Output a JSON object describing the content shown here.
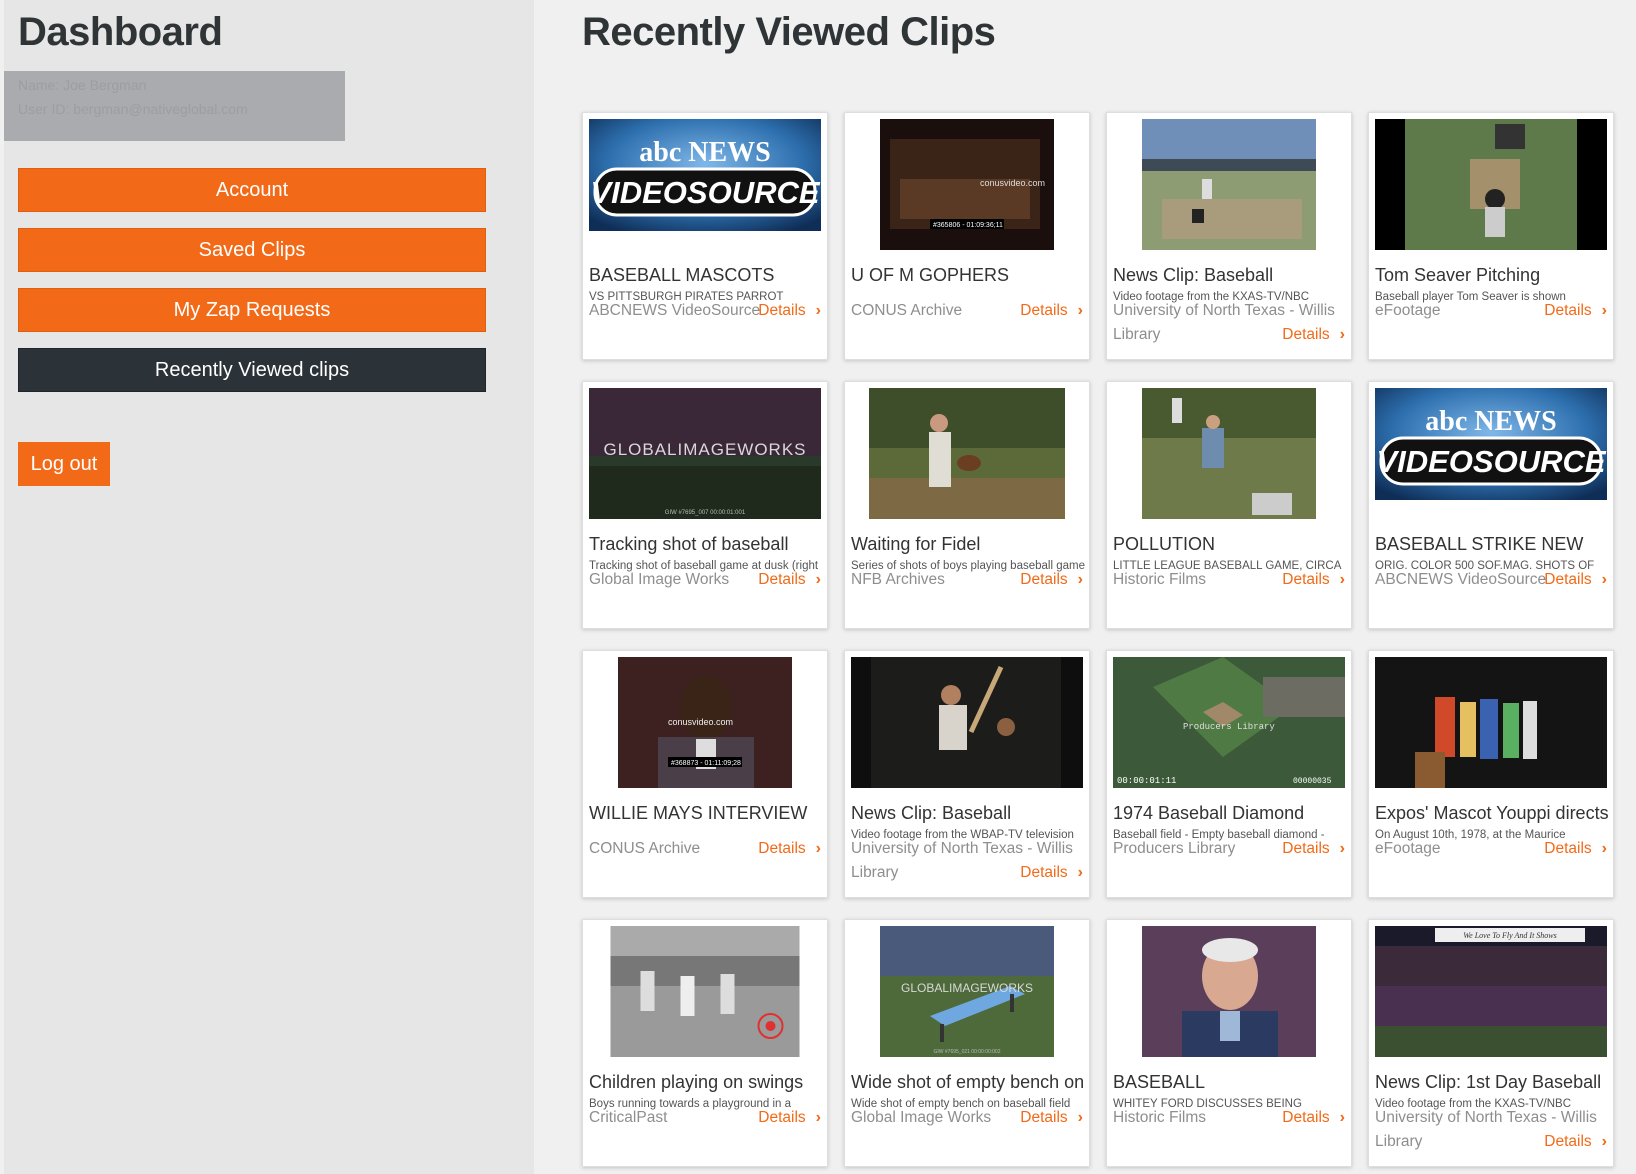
{
  "sidebar": {
    "title": "Dashboard",
    "user_name": "Name: Joe Bergman",
    "user_email": "User ID: bergman@nativeglobal.com",
    "nav": [
      {
        "label": "Account",
        "active": false
      },
      {
        "label": "Saved Clips",
        "active": false
      },
      {
        "label": "My Zap Requests",
        "active": false
      },
      {
        "label": "Recently Viewed clips",
        "active": true
      }
    ],
    "logout_label": "Log out"
  },
  "main": {
    "title": "Recently Viewed Clips",
    "details_label": "Details",
    "cards": [
      {
        "title": "BASEBALL MASCOTS",
        "desc": "VS PITTSBURGH PIRATES PARROT",
        "source": "ABCNEWS VideoSource",
        "thumb": "abc",
        "thumb_text": [
          "abc NEWS",
          "VIDEOSOURCE"
        ]
      },
      {
        "title": "U OF M GOPHERS",
        "desc": "",
        "source": "CONUS Archive",
        "thumb": "conus1",
        "thumb_text": [
          "conusvideo.com",
          "#365806 - 01:09:36;11"
        ]
      },
      {
        "title": "News Clip: Baseball",
        "desc": "Video footage from the KXAS-TV/NBC",
        "source": "University of North Texas - Willis Library",
        "thumb": "field1",
        "thumb_text": []
      },
      {
        "title": "Tom Seaver Pitching",
        "desc": "Baseball player Tom Seaver is shown",
        "source": "eFootage",
        "thumb": "pitch",
        "thumb_text": []
      },
      {
        "title": "Tracking shot of baseball",
        "desc": "Tracking shot of baseball game at dusk (right",
        "source": "Global Image Works",
        "thumb": "gw_night",
        "thumb_text": [
          "GLOBALIMAGEWORKS",
          "GIW #7695_007  00:00:01:001"
        ]
      },
      {
        "title": "Waiting for Fidel",
        "desc": "Series of shots of boys playing baseball game",
        "source": "NFB Archives",
        "thumb": "boy",
        "thumb_text": []
      },
      {
        "title": "POLLUTION",
        "desc": "LITTLE LEAGUE BASEBALL GAME, CIRCA",
        "source": "Historic Films",
        "thumb": "little",
        "thumb_text": []
      },
      {
        "title": "BASEBALL STRIKE NEW",
        "desc": "ORIG. COLOR 500 SOF.MAG. SHOTS OF",
        "source": "ABCNEWS VideoSource",
        "thumb": "abc",
        "thumb_text": [
          "abc NEWS",
          "VIDEOSOURCE"
        ]
      },
      {
        "title": "WILLIE MAYS INTERVIEW",
        "desc": "",
        "source": "CONUS Archive",
        "thumb": "conus2",
        "thumb_text": [
          "conusvideo.com",
          "#368873 - 01:11:09;28"
        ]
      },
      {
        "title": "News Clip: Baseball",
        "desc": "Video footage from the WBAP-TV television",
        "source": "University of North Texas - Willis Library",
        "thumb": "bat",
        "thumb_text": []
      },
      {
        "title": "1974 Baseball Diamond",
        "desc": "Baseball field - Empty baseball diamond -",
        "source": "Producers Library",
        "thumb": "aerial",
        "thumb_text": [
          "Producers Library",
          "00:00:01:11",
          "00000035"
        ]
      },
      {
        "title": "Expos' Mascot Youppi directs",
        "desc": "On August 10th, 1978, at the Maurice",
        "source": "eFootage",
        "thumb": "stage",
        "thumb_text": []
      },
      {
        "title": "Children playing on swings",
        "desc": "Boys running towards a playground in a",
        "source": "CriticalPast",
        "thumb": "bw",
        "thumb_text": []
      },
      {
        "title": "Wide shot of empty bench on",
        "desc": "Wide shot of empty bench on baseball field",
        "source": "Global Image Works",
        "thumb": "bench",
        "thumb_text": [
          "GLOBALIMAGEWORKS",
          "GIW #7695_021  00:00:00:002"
        ]
      },
      {
        "title": "BASEBALL",
        "desc": "WHITEY FORD DISCUSSES BEING",
        "source": "Historic Films",
        "thumb": "man",
        "thumb_text": []
      },
      {
        "title": "News Clip: 1st Day Baseball",
        "desc": "Video footage from the KXAS-TV/NBC",
        "source": "University of North Texas - Willis Library",
        "thumb": "crowd",
        "thumb_text": [
          "We Love To Fly And It Shows"
        ]
      }
    ]
  },
  "colors": {
    "accent": "#f26a18",
    "active_nav": "#2b3238",
    "sidebar_bg": "#e6e6e6",
    "page_bg": "#f0f0f0"
  },
  "icons": {
    "details": "chevron-right-icon"
  }
}
